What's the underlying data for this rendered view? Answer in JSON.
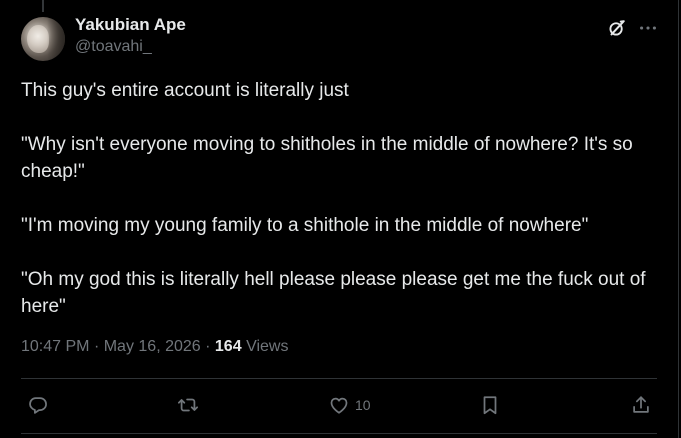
{
  "tweet": {
    "author": {
      "display_name": "Yakubian Ape",
      "handle": "@toavahi_"
    },
    "paragraphs": [
      "This guy's entire account is literally just",
      "\"Why isn't everyone moving to shitholes in the middle of nowhere? It's so cheap!\"",
      "\"I'm moving my young family to a shithole in the middle of nowhere\"",
      "\"Oh my god this is literally hell please please please get me the fuck out of here\""
    ],
    "time": "10:47 PM",
    "date": "May 16, 2026",
    "separator": "·",
    "views_count": "164",
    "views_label": "Views"
  },
  "actions": {
    "reply_count": "",
    "repost_count": "",
    "like_count": "10",
    "bookmark_count": ""
  },
  "icons": {
    "grok": "grok-icon",
    "more": "more-icon",
    "reply": "reply-icon",
    "repost": "repost-icon",
    "like": "heart-icon",
    "bookmark": "bookmark-icon",
    "share": "share-icon"
  },
  "colors": {
    "background": "#000000",
    "text_primary": "#e7e9ea",
    "text_secondary": "#71767b",
    "divider": "#2f3336"
  }
}
